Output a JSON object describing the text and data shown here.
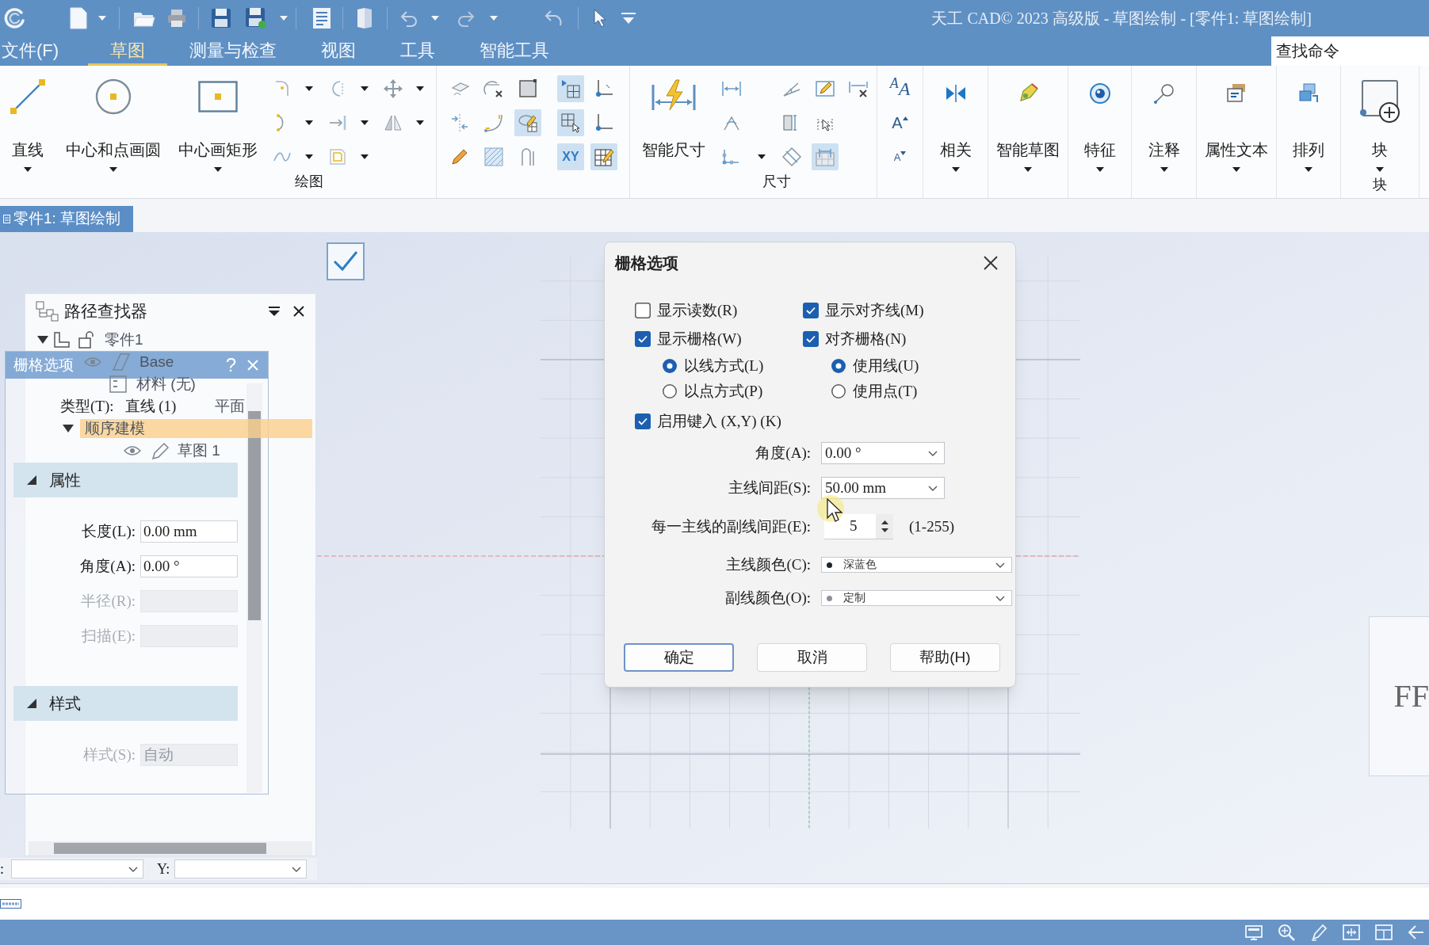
{
  "window": {
    "title": "天工 CAD© 2023 高级版 - 草图绘制 - [零件1: 草图绘制]"
  },
  "menu_tabs": [
    {
      "label": "文件(F)",
      "selected": false
    },
    {
      "label": "草图",
      "selected": true
    },
    {
      "label": "测量与检查",
      "selected": false
    },
    {
      "label": "视图",
      "selected": false
    },
    {
      "label": "工具",
      "selected": false
    },
    {
      "label": "智能工具",
      "selected": false
    }
  ],
  "command_search": {
    "placeholder": "查找命令"
  },
  "ribbon": {
    "draw_group": {
      "label": "绘图",
      "large_tools": [
        {
          "label": "直线"
        },
        {
          "label": "中心和点画圆"
        },
        {
          "label": "中心画矩形"
        }
      ]
    },
    "sketch_tools": [
      {
        "on": false
      },
      {
        "on": false
      },
      {
        "on": false
      },
      {
        "on": false
      },
      {
        "on": false
      },
      {
        "on": true
      },
      {
        "on": false
      },
      {
        "on": false
      },
      {
        "on": false
      }
    ],
    "relation_tools": [
      {
        "on": true
      },
      {
        "on": false
      },
      {
        "on": true
      },
      {
        "on": false
      },
      {
        "label": "XY",
        "on": true
      },
      {
        "on": true
      }
    ],
    "dimension_group": {
      "label": "尺寸",
      "smart_dimension": {
        "label": "智能尺寸"
      },
      "tools": [
        {
          "on": false
        },
        {
          "on": false
        },
        {
          "on": false
        },
        {
          "on": false
        },
        {
          "on": false
        },
        {
          "on": false
        },
        {
          "on": false
        },
        {
          "on": false
        },
        {
          "on": false
        },
        {
          "on": true
        }
      ]
    },
    "text_tools": [
      {
        "label": "$^{A}$A"
      },
      {
        "label": "A"
      },
      {
        "label": "A"
      }
    ],
    "commands": [
      {
        "label": "相关"
      },
      {
        "label": "智能草图"
      },
      {
        "label": "特征"
      },
      {
        "label": "注释"
      },
      {
        "label": "属性文本"
      },
      {
        "label": "排列"
      }
    ],
    "block_group": {
      "label": "块",
      "command": {
        "label": "块"
      }
    }
  },
  "document_tabs": [
    {
      "label": "零件1: 草图绘制",
      "selected": true
    }
  ],
  "pathfinder": {
    "title": "路径查找器",
    "tree": [
      {
        "kind": "part",
        "label": "零件1",
        "expanded": true,
        "selected": false,
        "children": [
          {
            "kind": "body",
            "label": "Base",
            "selected": false
          },
          {
            "kind": "material",
            "label": "材料 (无)",
            "selected": false
          },
          {
            "kind": "plane",
            "label": "平面",
            "selected": false
          },
          {
            "kind": "group",
            "label": "顺序建模",
            "expanded": true,
            "selected": true,
            "children": [
              {
                "kind": "sketch",
                "label": "草图 1",
                "selected": false
              }
            ]
          }
        ]
      }
    ]
  },
  "property_bar": {
    "title": "栅格选项",
    "help_button": "?",
    "type_field": {
      "label": "类型(T):",
      "value": "直线 (1)"
    },
    "sections": [
      {
        "title": "属性",
        "expanded": true,
        "fields": [
          {
            "label": "长度(L):",
            "value": "0.00 mm",
            "disabled": false
          },
          {
            "label": "角度(A):",
            "value": "0.00 °",
            "disabled": false
          },
          {
            "label": "半径(R):",
            "disabled": true
          },
          {
            "label": "扫描(E):",
            "disabled": true
          }
        ]
      },
      {
        "title": "样式",
        "expanded": true,
        "fields": [
          {
            "label": "样式(S):",
            "value": "自动",
            "disabled": true
          }
        ]
      }
    ]
  },
  "coordinates": [
    {
      "label": ":"
    },
    {
      "label": "Y:"
    }
  ],
  "grid_dialog": {
    "title": "栅格选项",
    "left_options": [
      {
        "kind": "checkbox",
        "label": "显示读数(R)",
        "checked": false
      },
      {
        "kind": "checkbox",
        "label": "显示栅格(W)",
        "checked": true
      },
      {
        "kind": "radio",
        "label": "以线方式(L)",
        "selected": true
      },
      {
        "kind": "radio",
        "label": "以点方式(P)",
        "selected": false
      }
    ],
    "right_options": [
      {
        "kind": "checkbox",
        "label": "显示对齐线(M)",
        "checked": true
      },
      {
        "kind": "checkbox",
        "label": "对齐栅格(N)",
        "checked": true
      },
      {
        "kind": "radio",
        "label": "使用线(U)",
        "selected": true
      },
      {
        "kind": "radio",
        "label": "使用点(T)",
        "selected": false
      }
    ],
    "enable_typing": {
      "label": "启用键入 (X,Y) (K)",
      "checked": true
    },
    "fields": [
      {
        "kind": "dropdown",
        "label": "角度(A):",
        "value": "0.00 °"
      },
      {
        "kind": "dropdown",
        "label": "主线间距(S):",
        "value": "50.00 mm"
      },
      {
        "kind": "spinner",
        "label": "每一主线的副线间距(E):",
        "value": "5",
        "range": "(1-255)"
      },
      {
        "kind": "color",
        "label": "主线颜色(C):",
        "value": "深蓝色",
        "color": "#1c2333"
      },
      {
        "kind": "color",
        "label": "副线颜色(O):",
        "value": "定制",
        "color": "#8c9099"
      }
    ],
    "buttons": [
      {
        "label": "确定",
        "default": true
      },
      {
        "label": "取消",
        "default": false
      },
      {
        "label": "帮助(H)",
        "default": false
      }
    ]
  },
  "title_block": {
    "text": "FF"
  }
}
